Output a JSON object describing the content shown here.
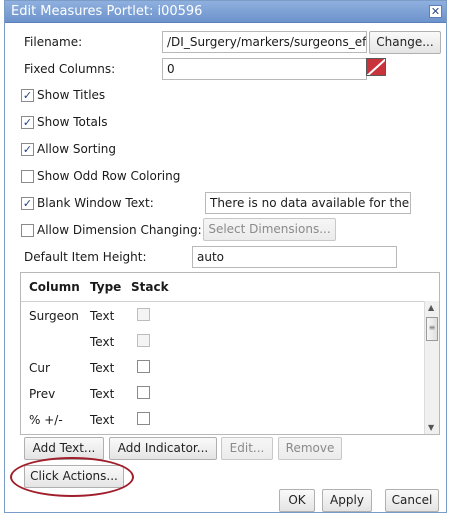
{
  "dialog": {
    "title": "Edit Measures Portlet: i00596",
    "close_icon": "close-icon"
  },
  "form": {
    "filename_label": "Filename:",
    "filename_value": "/DI_Surgery/markers/surgeons_effi",
    "change_button": "Change...",
    "fixed_columns_label": "Fixed Columns:",
    "fixed_columns_value": "0",
    "show_titles": {
      "label": "Show Titles",
      "checked": true
    },
    "show_totals": {
      "label": "Show Totals",
      "checked": true
    },
    "allow_sorting": {
      "label": "Allow Sorting",
      "checked": true
    },
    "show_odd_row_coloring": {
      "label": "Show Odd Row Coloring",
      "checked": false
    },
    "blank_window_text": {
      "label": "Blank Window Text:",
      "checked": true,
      "value": "There is no data available for the s"
    },
    "allow_dimension_changing": {
      "label": "Allow Dimension Changing:",
      "checked": false
    },
    "select_dimensions_button": "Select Dimensions...",
    "default_item_height_label": "Default Item Height:",
    "default_item_height_value": "auto"
  },
  "table": {
    "headers": [
      "Column",
      "Type",
      "Stack"
    ],
    "rows": [
      {
        "column": "Surgeon",
        "type": "Text",
        "stack_enabled": false
      },
      {
        "column": "",
        "type": "Text",
        "stack_enabled": false
      },
      {
        "column": "Cur",
        "type": "Text",
        "stack_enabled": true
      },
      {
        "column": "Prev",
        "type": "Text",
        "stack_enabled": true
      },
      {
        "column": "% +/-",
        "type": "Text",
        "stack_enabled": true
      }
    ]
  },
  "buttons": {
    "add_text": "Add Text...",
    "add_indicator": "Add Indicator...",
    "edit": "Edit...",
    "remove": "Remove",
    "click_actions": "Click Actions...",
    "ok": "OK",
    "apply": "Apply",
    "cancel": "Cancel"
  },
  "colors": {
    "titlebar": "#7ea3d8",
    "annotation_ellipse": "#a01e2b",
    "color_swatch": "#c8333c"
  }
}
